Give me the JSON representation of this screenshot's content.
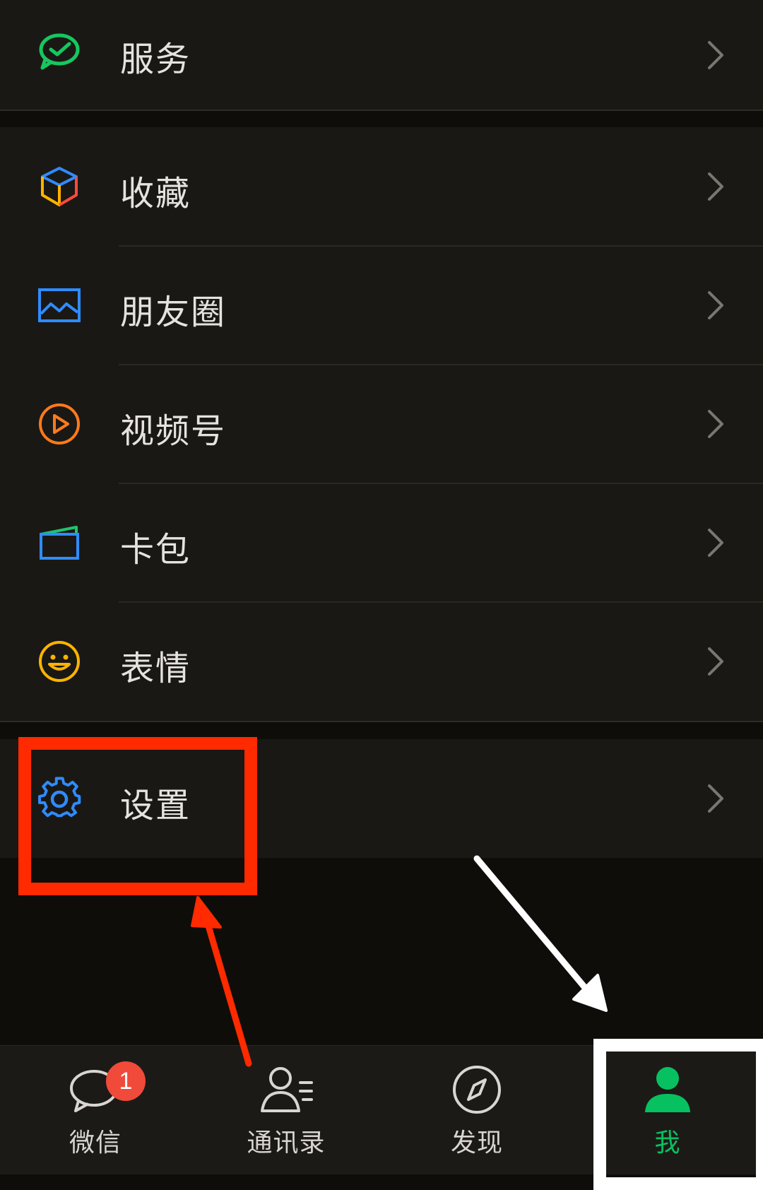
{
  "menu": {
    "items": [
      {
        "label": "服务",
        "icon": "service-icon"
      },
      {
        "label": "收藏",
        "icon": "favorites-cube-icon"
      },
      {
        "label": "朋友圈",
        "icon": "moments-image-icon"
      },
      {
        "label": "视频号",
        "icon": "channels-play-icon"
      },
      {
        "label": "卡包",
        "icon": "card-wallet-icon"
      },
      {
        "label": "表情",
        "icon": "sticker-smile-icon"
      },
      {
        "label": "设置",
        "icon": "gear-icon"
      }
    ]
  },
  "tabbar": {
    "tabs": [
      {
        "label": "微信",
        "icon": "chat-bubble-icon",
        "badge": "1"
      },
      {
        "label": "通讯录",
        "icon": "contacts-icon"
      },
      {
        "label": "发现",
        "icon": "compass-icon"
      },
      {
        "label": "我",
        "icon": "person-icon",
        "active": true
      }
    ]
  },
  "colors": {
    "active": "#07c160",
    "highlight_red": "#ff2a00",
    "highlight_white": "#ffffff"
  }
}
